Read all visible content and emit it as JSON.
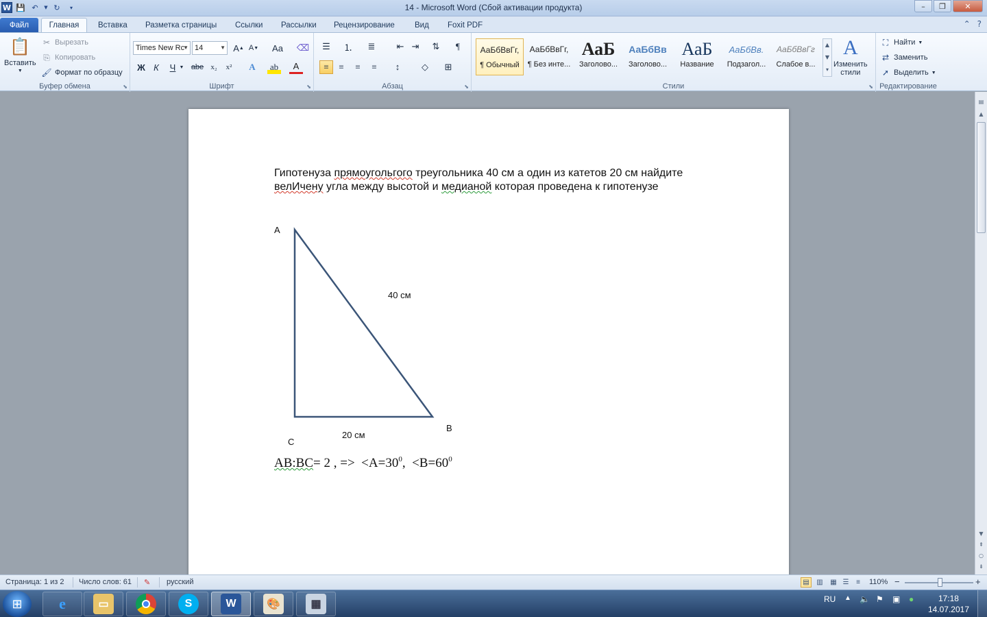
{
  "window": {
    "title": "14  -  Microsoft Word (Сбой активации продукта)",
    "app_icon": "W",
    "controls": [
      "–",
      "❐",
      "✕"
    ]
  },
  "tabs": [
    "Файл",
    "Главная",
    "Вставка",
    "Разметка страницы",
    "Ссылки",
    "Рассылки",
    "Рецензирование",
    "Вид",
    "Foxit PDF"
  ],
  "ribbon": {
    "clipboard": {
      "label": "Буфер обмена",
      "paste": "Вставить",
      "cut": "Вырезать",
      "copy": "Копировать",
      "format_painter": "Формат по образцу"
    },
    "font": {
      "label": "Шрифт",
      "font_name": "Times New Rc",
      "font_size": "14",
      "bold": "Ж",
      "italic": "К",
      "underline": "Ч",
      "strike": "abe",
      "sub": "x₂",
      "sup": "x²",
      "change_case": "Aa"
    },
    "paragraph": {
      "label": "Абзац"
    },
    "styles": {
      "label": "Стили",
      "items": [
        {
          "preview": "АаБбВвГг,",
          "name": "¶ Обычный"
        },
        {
          "preview": "АаБбВвГг,",
          "name": "¶ Без инте..."
        },
        {
          "preview": "АаБ",
          "name": "Заголово..."
        },
        {
          "preview": "АаБбВв",
          "name": "Заголово..."
        },
        {
          "preview": "АаБ",
          "name": "Название"
        },
        {
          "preview": "АаБбВв.",
          "name": "Подзагол..."
        },
        {
          "preview": "АаБбВвГг",
          "name": "Слабое в..."
        }
      ],
      "change_styles_line1": "Изменить",
      "change_styles_line2": "стили"
    },
    "editing": {
      "label": "Редактирование",
      "find": "Найти",
      "replace": "Заменить",
      "select": "Выделить"
    }
  },
  "document": {
    "para_p1": "Гипотенуза ",
    "para_w1": "прямоугольгого",
    "para_p2": " треугольника 40 см а один из катетов 20 см найдите",
    "para_w2": "велИчену",
    "para_p3": " угла между высотой и ",
    "para_w3": "медианой",
    "para_p4": " которая проведена к гипотенузе",
    "triangle": {
      "label_a": "A",
      "label_b": "B",
      "label_c": "C",
      "hyp_label": "40 см",
      "leg_label": "20 см",
      "line_color": "#3b5578"
    },
    "formula_ab_bc": "AB:BC",
    "formula_rest": "= 2 , =>  <A=30",
    "formula_deg1": "0",
    "formula_comma": ",  <B=60",
    "formula_deg2": "0"
  },
  "status_bar": {
    "page": "Страница: 1 из 2",
    "words": "Число слов: 61",
    "language": "русский",
    "zoom": "110%",
    "zoom_minus": "−",
    "zoom_plus": "+"
  },
  "taskbar": {
    "apps": [
      "windows-explorer",
      "internet-explorer",
      "file-manager",
      "chrome",
      "skype",
      "word",
      "paint",
      "calculator"
    ],
    "lang": "RU",
    "time": "17:18",
    "date": "14.07.2017"
  }
}
